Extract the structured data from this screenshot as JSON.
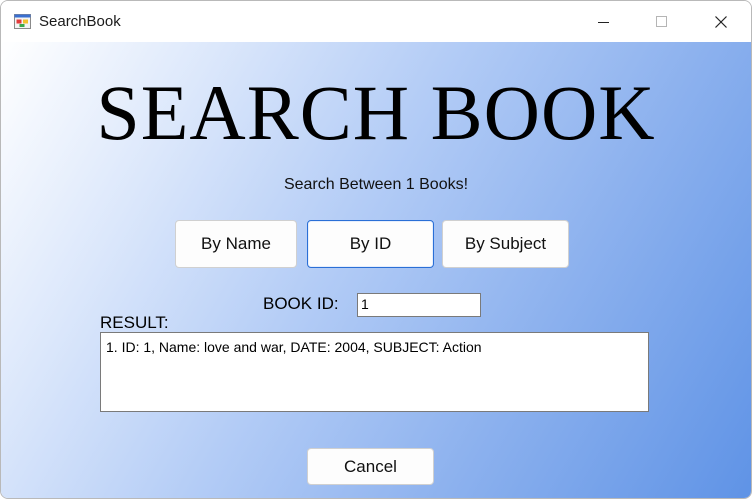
{
  "window": {
    "title": "SearchBook",
    "icon": "app-window-icon",
    "controls": [
      "minimize-icon",
      "maximize-icon",
      "close-icon"
    ]
  },
  "main": {
    "heading": "SEARCH BOOK",
    "subtitle": "Search Between 1 Books!",
    "tabs": [
      {
        "label": "By Name",
        "active": false
      },
      {
        "label": "By ID",
        "active": true
      },
      {
        "label": "By Subject",
        "active": false
      }
    ],
    "book_id_label": "BOOK ID:",
    "book_id_value": "1",
    "result_label": "RESULT:",
    "result_text": "1. ID: 1, Name: love and war, DATE: 2004, SUBJECT: Action",
    "cancel_label": "Cancel"
  },
  "colors": {
    "gradient_start": "#ffffff",
    "gradient_end": "#5f93e6",
    "active_border": "#2a6fd6"
  }
}
